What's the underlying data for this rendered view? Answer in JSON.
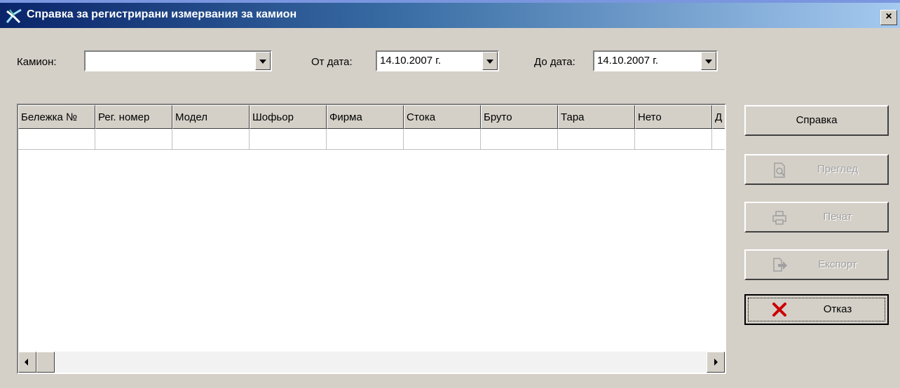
{
  "window": {
    "title": "Справка за регистрирани измервания за камион",
    "close_label": "×"
  },
  "filters": {
    "truck_label": "Камион:",
    "truck_value": "",
    "from_label": "От дата:",
    "from_value": "14.10.2007 г.",
    "to_label": "До дата:",
    "to_value": "14.10.2007 г."
  },
  "grid": {
    "columns": [
      "Бележка №",
      "Рег. номер",
      "Модел",
      "Шофьор",
      "Фирма",
      "Стока",
      "Бруто",
      "Тара",
      "Нето",
      "Д"
    ]
  },
  "buttons": {
    "report": "Справка",
    "preview": "Преглед",
    "print": "Печат",
    "export": "Експорт",
    "cancel": "Отказ"
  },
  "colors": {
    "title_start": "#0a246a",
    "title_end": "#a6caf0",
    "face": "#d4d0c8",
    "cancel_icon": "#cc0000"
  },
  "icons": {
    "app": "app-icon",
    "preview": "preview-icon",
    "print": "printer-icon",
    "export": "export-icon",
    "cancel": "red-x-icon"
  }
}
